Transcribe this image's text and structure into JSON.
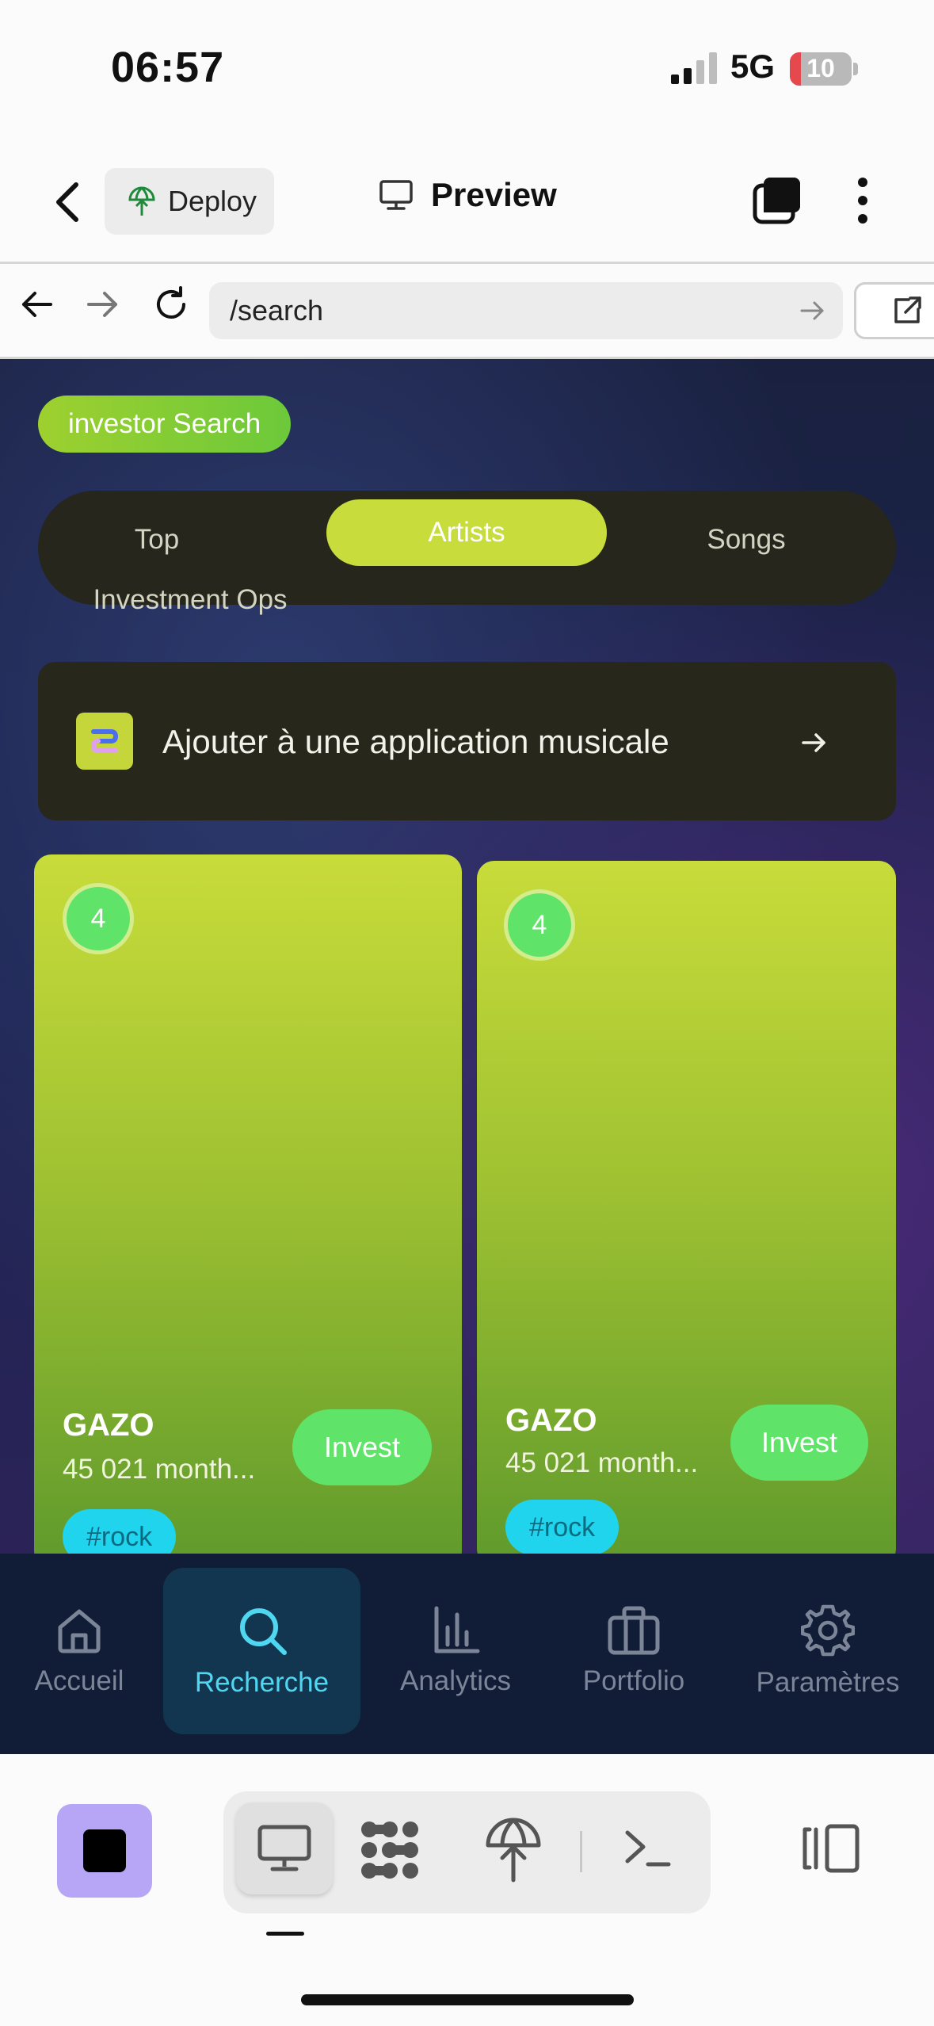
{
  "status_bar": {
    "time": "06:57",
    "network": "5G",
    "battery": "10"
  },
  "toolbar": {
    "deploy_label": "Deploy",
    "preview_label": "Preview"
  },
  "url_bar": {
    "path": "/search"
  },
  "app": {
    "title_pill": "investor Search",
    "tabs": [
      {
        "label": "Top",
        "selected": false
      },
      {
        "label": "Artists",
        "selected": true
      },
      {
        "label": "Songs",
        "selected": false
      },
      {
        "label": "Investment Ops",
        "selected": false
      }
    ],
    "banner": {
      "text": "Ajouter à une application musicale"
    },
    "cards": [
      {
        "rank": "4",
        "name": "GAZO",
        "listeners": "45 021 month...",
        "invest_label": "Invest",
        "tag": "#rock"
      },
      {
        "rank": "4",
        "name": "GAZO",
        "listeners": "45 021 month...",
        "invest_label": "Invest",
        "tag": "#rock"
      }
    ]
  },
  "bottom_nav": {
    "items": [
      {
        "label": "Accueil",
        "icon": "home-icon",
        "active": false
      },
      {
        "label": "Recherche",
        "icon": "search-icon",
        "active": true
      },
      {
        "label": "Analytics",
        "icon": "bar-chart-icon",
        "active": false
      },
      {
        "label": "Portfolio",
        "icon": "briefcase-icon",
        "active": false
      },
      {
        "label": "Paramètres",
        "icon": "gear-icon",
        "active": false
      }
    ]
  },
  "dev_toolbar": {
    "icons": [
      "stop-icon",
      "monitor-icon",
      "grid-dots-icon",
      "deploy-icon",
      "terminal-icon",
      "split-view-icon"
    ]
  },
  "colors": {
    "accent_lime": "#c8dc3c",
    "invest_green": "#5fe368",
    "tag_cyan": "#20d4ee",
    "nav_active": "#4fd6f0",
    "stop_purple": "#b7a6f6"
  }
}
